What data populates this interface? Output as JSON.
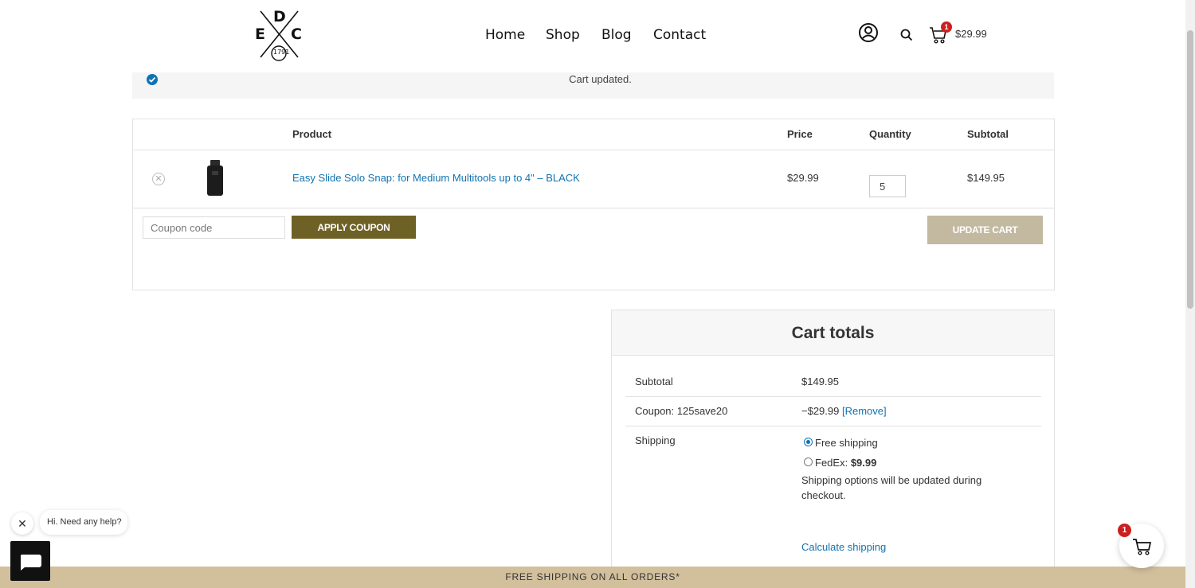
{
  "header": {
    "logo": {
      "top": "D",
      "left": "E",
      "right": "C",
      "bottom": "1791"
    },
    "nav": [
      "Home",
      "Shop",
      "Blog",
      "Contact"
    ],
    "cart_count": "1",
    "cart_total": "$29.99"
  },
  "notice": {
    "text": "Cart updated."
  },
  "cart": {
    "headers": {
      "product": "Product",
      "price": "Price",
      "quantity": "Quantity",
      "subtotal": "Subtotal"
    },
    "item": {
      "name": "Easy Slide Solo Snap: for Medium Multitools up to 4\" – BLACK",
      "price": "$29.99",
      "quantity": "5",
      "subtotal": "$149.95"
    },
    "coupon_placeholder": "Coupon code",
    "apply_label": "APPLY COUPON",
    "update_label": "UPDATE CART"
  },
  "totals": {
    "title": "Cart totals",
    "subtotal_label": "Subtotal",
    "subtotal_value": "$149.95",
    "coupon_label": "Coupon: 125save20",
    "coupon_value": "−$29.99",
    "coupon_remove": "[Remove]",
    "shipping_label": "Shipping",
    "free_shipping": "Free shipping",
    "fedex_label": "FedEx:",
    "fedex_price": "$9.99",
    "shipping_note_1": "Shipping options will be updated during",
    "shipping_note_2": "checkout.",
    "calculate_link": "Calculate shipping"
  },
  "chat": {
    "close": "✕",
    "greeting": "Hi. Need any help?"
  },
  "floating_cart": {
    "count": "1"
  },
  "footer_bar": "FREE SHIPPING ON ALL ORDERS*",
  "colors": {
    "accent_link": "#1273b0",
    "apply_button": "#6e6126",
    "update_button": "#c2b9a0",
    "banner": "#d2bf9c",
    "badge": "#cc1f1f"
  }
}
